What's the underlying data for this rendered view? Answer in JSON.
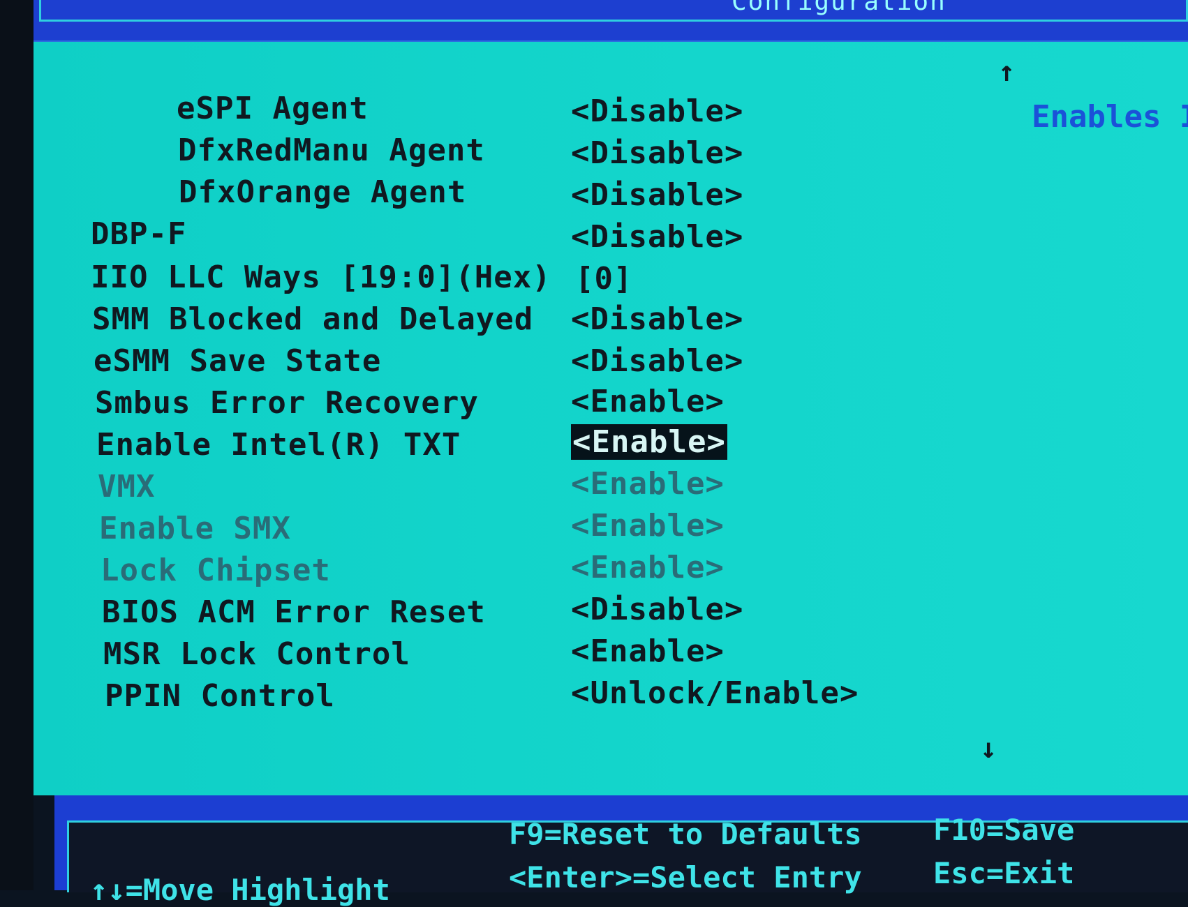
{
  "header": {
    "title": "Configuration"
  },
  "scroll": {
    "up_arrow": "↑",
    "down_arrow": "↓"
  },
  "help": {
    "text": "Enables In"
  },
  "settings": [
    {
      "label": "eSPI Agent",
      "value": "<Disable>"
    },
    {
      "label": "DfxRedManu Agent",
      "value": "<Disable>"
    },
    {
      "label": "DfxOrange Agent",
      "value": "<Disable>"
    },
    {
      "label": "DBP-F",
      "value": "<Disable>"
    },
    {
      "label": "IIO LLC Ways [19:0](Hex)",
      "value": "[0]"
    },
    {
      "label": "SMM Blocked and Delayed",
      "value": "<Disable>"
    },
    {
      "label": "eSMM Save State",
      "value": "<Disable>"
    },
    {
      "label": "Smbus Error Recovery",
      "value": "<Enable>"
    },
    {
      "label": "Enable Intel(R) TXT",
      "value": "<Enable>"
    },
    {
      "label": "VMX",
      "value": "<Enable>"
    },
    {
      "label": "Enable SMX",
      "value": "<Enable>"
    },
    {
      "label": "Lock Chipset",
      "value": "<Enable>"
    },
    {
      "label": "BIOS ACM Error Reset",
      "value": "<Disable>"
    },
    {
      "label": "MSR Lock Control",
      "value": "<Enable>"
    },
    {
      "label": "PPIN Control",
      "value": "<Unlock/Enable>"
    }
  ],
  "footer": {
    "f9": "F9=Reset to Defaults",
    "f10": "F10=Save",
    "enter": "<Enter>=Select Entry",
    "esc": "Esc=Exit",
    "left": "↑↓=Move Highlight"
  }
}
